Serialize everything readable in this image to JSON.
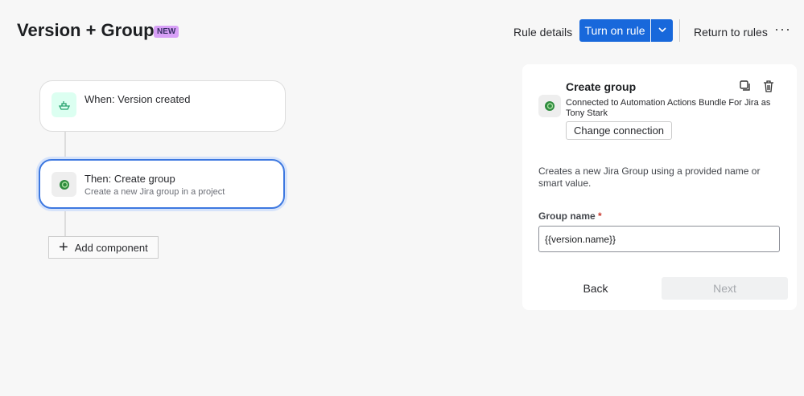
{
  "header": {
    "title": "Version + Group",
    "badge": "NEW",
    "rule_details": "Rule details",
    "turn_on": "Turn on rule",
    "return": "Return to rules",
    "more": "···"
  },
  "flow": {
    "trigger": {
      "title": "When: Version created",
      "icon": "ship-icon"
    },
    "action": {
      "title": "Then: Create group",
      "subtitle": "Create a new Jira group in a project",
      "icon": "app-icon"
    },
    "add_component": "Add component"
  },
  "panel": {
    "title": "Create group",
    "connection": "Connected to Automation Actions Bundle For Jira as Tony Stark",
    "change_connection": "Change connection",
    "description": "Creates a new Jira Group using a provided name or smart value.",
    "field_label": "Group name",
    "required_mark": "*",
    "field_value": "{{version.name}}",
    "back": "Back",
    "next": "Next"
  },
  "colors": {
    "primary": "#1868db",
    "badge": "#d8a0f7",
    "selected_border": "#3d78e0"
  }
}
